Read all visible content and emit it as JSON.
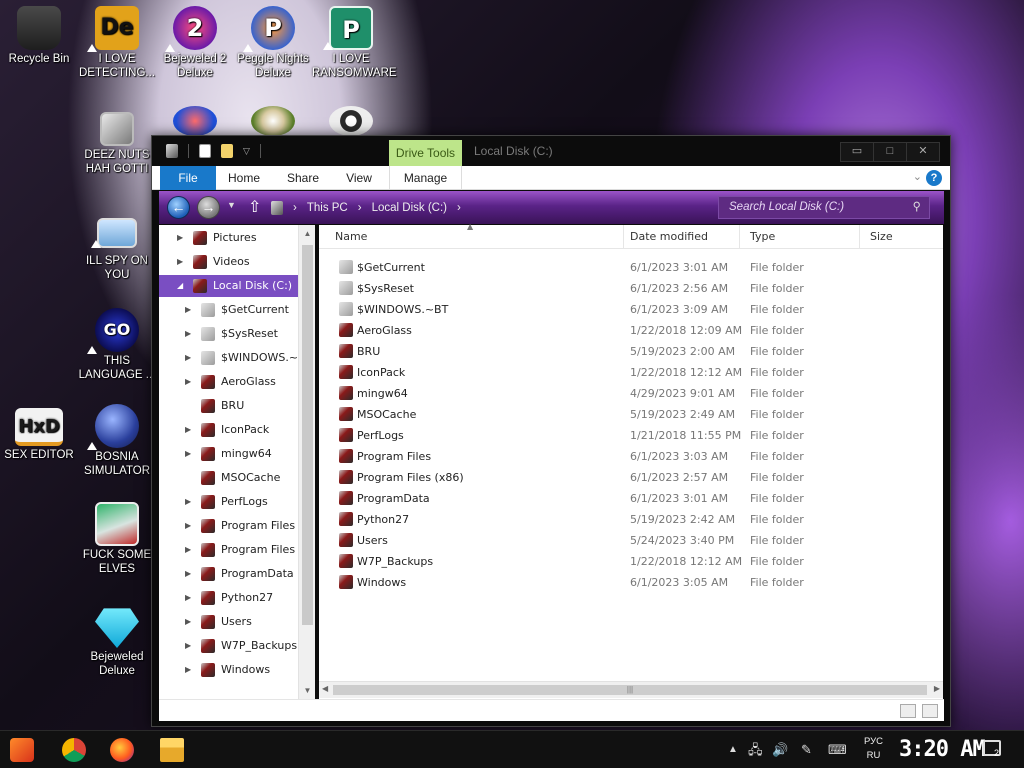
{
  "desktop": {
    "icons": [
      {
        "label": "Recycle Bin"
      },
      {
        "label": "I LOVE DETECTING..."
      },
      {
        "label": "Bejeweled 2 Deluxe"
      },
      {
        "label": "Peggle Nights Deluxe"
      },
      {
        "label": "I LOVE RANSOMWARE"
      },
      {
        "label": "DEEZ NUTS HAH GOTTI"
      },
      {
        "label": "ILL SPY ON YOU"
      },
      {
        "label": "THIS LANGUAGE ..."
      },
      {
        "label": "SEX EDITOR"
      },
      {
        "label": "BOSNIA SIMULATOR"
      },
      {
        "label": "FUCK SOME ELVES"
      },
      {
        "label": "Bejeweled Deluxe"
      }
    ]
  },
  "window": {
    "title": "Local Disk (C:)",
    "contextual_tab": "Drive Tools",
    "controls": {
      "minimize": "▭",
      "maximize": "□",
      "close": "✕"
    }
  },
  "ribbon": {
    "tabs": [
      "File",
      "Home",
      "Share",
      "View",
      "Manage"
    ],
    "help": "?"
  },
  "address": {
    "crumbs": [
      "This PC",
      "Local Disk (C:)"
    ],
    "search_placeholder": "Search Local Disk (C:)"
  },
  "nav_pane": {
    "items": [
      {
        "label": "Pictures",
        "selected": false
      },
      {
        "label": "Videos",
        "selected": false
      },
      {
        "label": "Local Disk (C:)",
        "selected": true
      },
      {
        "label": "$GetCurrent",
        "selected": false
      },
      {
        "label": "$SysReset",
        "selected": false
      },
      {
        "label": "$WINDOWS.~",
        "selected": false
      },
      {
        "label": "AeroGlass",
        "selected": false
      },
      {
        "label": "BRU",
        "selected": false
      },
      {
        "label": "IconPack",
        "selected": false
      },
      {
        "label": "mingw64",
        "selected": false
      },
      {
        "label": "MSOCache",
        "selected": false
      },
      {
        "label": "PerfLogs",
        "selected": false
      },
      {
        "label": "Program Files",
        "selected": false
      },
      {
        "label": "Program Files (x",
        "selected": false
      },
      {
        "label": "ProgramData",
        "selected": false
      },
      {
        "label": "Python27",
        "selected": false
      },
      {
        "label": "Users",
        "selected": false
      },
      {
        "label": "W7P_Backups",
        "selected": false
      },
      {
        "label": "Windows",
        "selected": false
      }
    ]
  },
  "file_list": {
    "columns": [
      "Name",
      "Date modified",
      "Type",
      "Size"
    ],
    "rows": [
      {
        "name": "$GetCurrent",
        "date": "6/1/2023 3:01 AM",
        "type": "File folder"
      },
      {
        "name": "$SysReset",
        "date": "6/1/2023 2:56 AM",
        "type": "File folder"
      },
      {
        "name": "$WINDOWS.~BT",
        "date": "6/1/2023 3:09 AM",
        "type": "File folder"
      },
      {
        "name": "AeroGlass",
        "date": "1/22/2018 12:09 AM",
        "type": "File folder"
      },
      {
        "name": "BRU",
        "date": "5/19/2023 2:00 AM",
        "type": "File folder"
      },
      {
        "name": "IconPack",
        "date": "1/22/2018 12:12 AM",
        "type": "File folder"
      },
      {
        "name": "mingw64",
        "date": "4/29/2023 9:01 AM",
        "type": "File folder"
      },
      {
        "name": "MSOCache",
        "date": "5/19/2023 2:49 AM",
        "type": "File folder"
      },
      {
        "name": "PerfLogs",
        "date": "1/21/2018 11:55 PM",
        "type": "File folder"
      },
      {
        "name": "Program Files",
        "date": "6/1/2023 3:03 AM",
        "type": "File folder"
      },
      {
        "name": "Program Files (x86)",
        "date": "6/1/2023 2:57 AM",
        "type": "File folder"
      },
      {
        "name": "ProgramData",
        "date": "6/1/2023 3:01 AM",
        "type": "File folder"
      },
      {
        "name": "Python27",
        "date": "5/19/2023 2:42 AM",
        "type": "File folder"
      },
      {
        "name": "Users",
        "date": "5/24/2023 3:40 PM",
        "type": "File folder"
      },
      {
        "name": "W7P_Backups",
        "date": "1/22/2018 12:12 AM",
        "type": "File folder"
      },
      {
        "name": "Windows",
        "date": "6/1/2023 3:05 AM",
        "type": "File folder"
      }
    ]
  },
  "taskbar": {
    "apps": [
      "start-icon",
      "chrome-icon",
      "firefox-icon",
      "file-explorer-icon"
    ],
    "lang_top": "РУС",
    "lang_bottom": "RU",
    "clock": "3:20 AM",
    "notifications": "2"
  },
  "colors": {
    "accent": "#1979ca",
    "selection": "#7a4ec2",
    "drive_tools": "#bde58a",
    "address_bar": "#5a2387"
  }
}
